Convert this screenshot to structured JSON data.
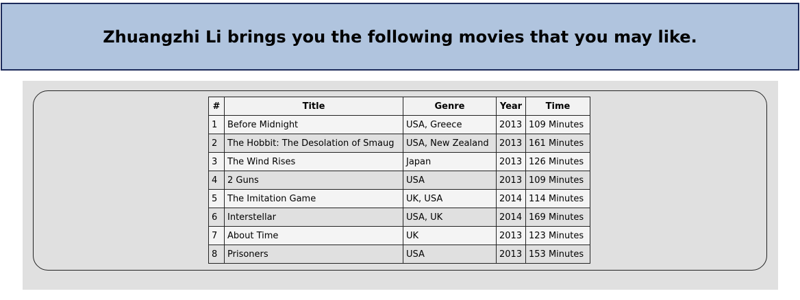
{
  "header": {
    "title": "Zhuangzhi Li brings you the following movies that you may like."
  },
  "table": {
    "columns": [
      "#",
      "Title",
      "Genre",
      "Year",
      "Time"
    ],
    "rows": [
      [
        "1",
        "Before Midnight",
        "USA, Greece",
        "2013",
        "109 Minutes"
      ],
      [
        "2",
        "The Hobbit: The Desolation of Smaug",
        "USA, New Zealand",
        "2013",
        "161 Minutes"
      ],
      [
        "3",
        "The Wind Rises",
        "Japan",
        "2013",
        "126 Minutes"
      ],
      [
        "4",
        "2 Guns",
        "USA",
        "2013",
        "109 Minutes"
      ],
      [
        "5",
        "The Imitation Game",
        "UK, USA",
        "2014",
        "114 Minutes"
      ],
      [
        "6",
        "Interstellar",
        "USA, UK",
        "2014",
        "169 Minutes"
      ],
      [
        "7",
        "About Time",
        "UK",
        "2013",
        "123 Minutes"
      ],
      [
        "8",
        "Prisoners",
        "USA",
        "2013",
        "153 Minutes"
      ]
    ]
  },
  "colors": {
    "header_bg": "#b0c4de",
    "header_border": "#1c2a5a",
    "panel_bg": "#e0e0e0"
  }
}
